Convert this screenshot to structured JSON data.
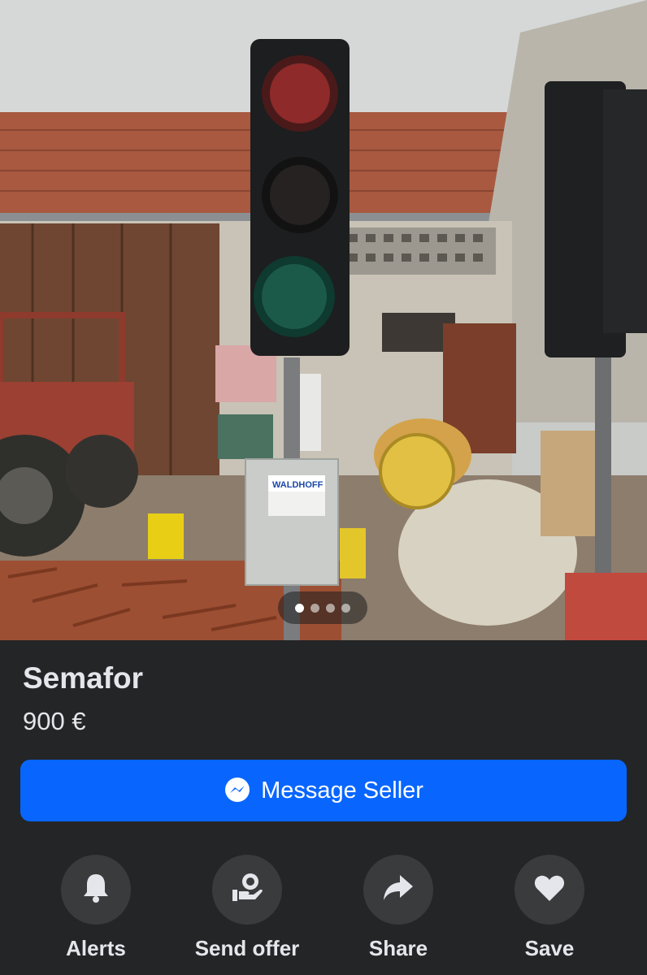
{
  "listing": {
    "title": "Semafor",
    "price": "900 €",
    "image_description_icon": "traffic-light-photo"
  },
  "carousel": {
    "total": 4,
    "active_index": 0
  },
  "primary_action": {
    "label": "Message Seller",
    "icon": "messenger-icon",
    "color": "#0866ff"
  },
  "actions": [
    {
      "label": "Alerts",
      "icon": "bell-icon"
    },
    {
      "label": "Send offer",
      "icon": "offer-icon"
    },
    {
      "label": "Share",
      "icon": "share-icon"
    },
    {
      "label": "Save",
      "icon": "heart-icon"
    }
  ],
  "photo_text": {
    "box_brand": "WALDHOFF"
  }
}
